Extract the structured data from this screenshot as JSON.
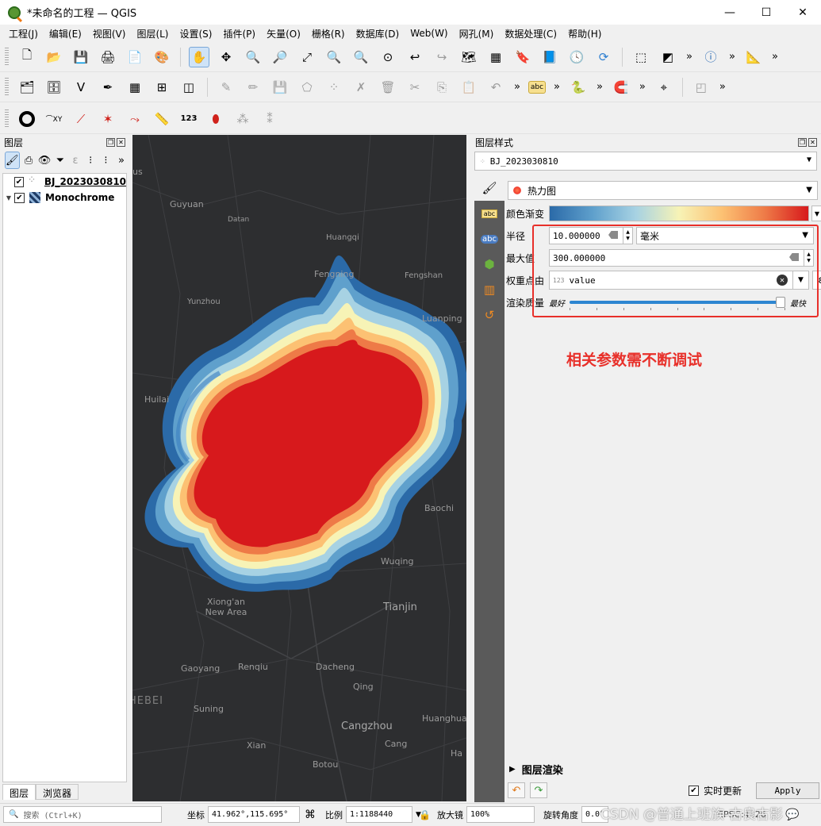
{
  "window": {
    "title": "*未命名的工程 — QGIS",
    "minimize": "—",
    "maximize": "☐",
    "close": "✕"
  },
  "menu": [
    "工程(J)",
    "编辑(E)",
    "视图(V)",
    "图层(L)",
    "设置(S)",
    "插件(P)",
    "矢量(O)",
    "栅格(R)",
    "数据库(D)",
    "Web(W)",
    "网孔(M)",
    "数据处理(C)",
    "帮助(H)"
  ],
  "layers_panel": {
    "title": "图层",
    "layers": [
      {
        "name": "BJ_2023030810",
        "checked": true
      },
      {
        "name": "Monochrome",
        "checked": true
      }
    ],
    "tabs": [
      "图层",
      "浏览器"
    ]
  },
  "map": {
    "places": [
      {
        "name": "Guyuan"
      },
      {
        "name": "Datan"
      },
      {
        "name": "Huangqi"
      },
      {
        "name": "Fengning"
      },
      {
        "name": "Fengshan"
      },
      {
        "name": "Yunzhou"
      },
      {
        "name": "Luanping"
      },
      {
        "name": "Huilai"
      },
      {
        "name": "Baochi"
      },
      {
        "name": "Wuqing"
      },
      {
        "name": "Xiong'an New Area"
      },
      {
        "name": "Tianjin"
      },
      {
        "name": "Gaoyang"
      },
      {
        "name": "Renqiu"
      },
      {
        "name": "Dacheng"
      },
      {
        "name": "Qing"
      },
      {
        "name": "HEBEI"
      },
      {
        "name": "Suning"
      },
      {
        "name": "Cangzhou"
      },
      {
        "name": "Huanghua"
      },
      {
        "name": "Xian"
      },
      {
        "name": "Cang"
      },
      {
        "name": "Botou"
      },
      {
        "name": "Ha"
      },
      {
        "name": "us"
      }
    ]
  },
  "style_panel": {
    "title": "图层样式",
    "layer": "BJ_2023030810",
    "renderer": "热力图",
    "color_ramp_label": "颜色渐变",
    "radius_label": "半径",
    "radius_value": "10.000000",
    "radius_unit": "毫米",
    "max_label": "最大值",
    "max_value": "300.000000",
    "weight_label": "权重点由",
    "weight_value": "value",
    "weight_type": "123",
    "quality_label": "渲染质量",
    "quality_best": "最好",
    "quality_fast": "最快",
    "quality_level": 1.0,
    "layer_rendering": "图层渲染",
    "live_update": "实时更新",
    "live_update_checked": true,
    "apply": "Apply"
  },
  "annotation": "相关参数需不断调试",
  "statusbar": {
    "search_placeholder": "搜索 (Ctrl+K)",
    "coord_label": "坐标",
    "coord_value": "41.962°,115.695°",
    "scale_label": "比例",
    "scale_value": "1:1188440",
    "magnifier_label": "放大镜",
    "magnifier_value": "100%",
    "rotation_label": "旋转角度",
    "rotation_value": "0.0°",
    "epsg": "EPSG:4326"
  },
  "watermark": "CSDN @普通上班族-古良古影",
  "colors": {
    "heat_red": "#d7191c",
    "heat_blue": "#2b83ba",
    "map_bg": "#2d2e30",
    "annotation_red": "#e8302a"
  }
}
